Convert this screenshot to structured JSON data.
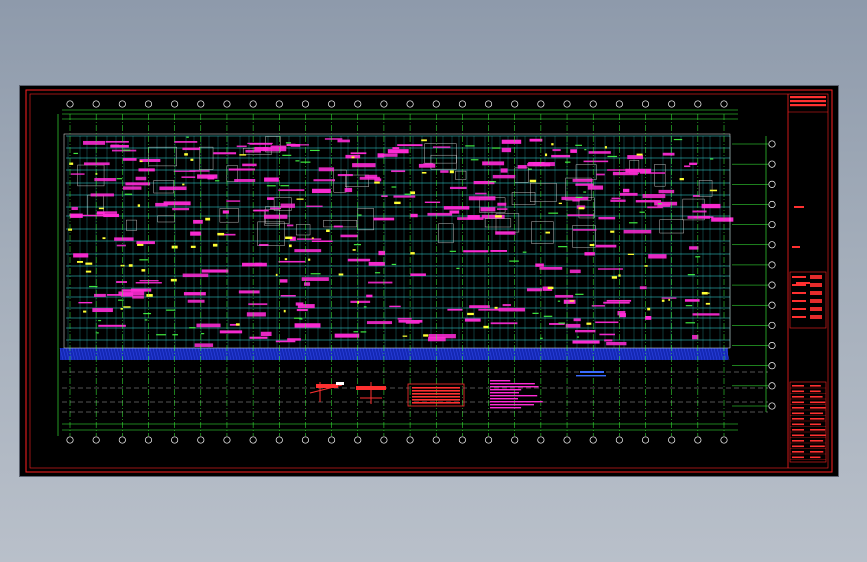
{
  "viewer": {
    "background_top": "#8e9aab",
    "background_bottom": "#b9c0ca"
  },
  "drawing": {
    "paper_color": "#000000",
    "frame_color": "#ff2020",
    "axis_color": "#3cff3c",
    "grid_color": "#39e6e6",
    "annotation_color": "#ff2bd6",
    "highlight_color": "#ffff33",
    "band_color": "#1428b4",
    "legend_color": "#ff3030",
    "note_color": "#ff2bd6",
    "column_axis_count": 26,
    "row_axis_count": 14,
    "title_block": {
      "header_lines": 3,
      "field_rows": 14
    },
    "details": [
      {
        "name": "detail-symbol-a",
        "color": "#ff3030"
      },
      {
        "name": "detail-symbol-b",
        "color": "#ff3030"
      },
      {
        "name": "legend-table",
        "color": "#ff3030"
      },
      {
        "name": "general-notes",
        "color": "#ff2bd6"
      },
      {
        "name": "small-note",
        "color": "#3a6bff"
      }
    ]
  }
}
